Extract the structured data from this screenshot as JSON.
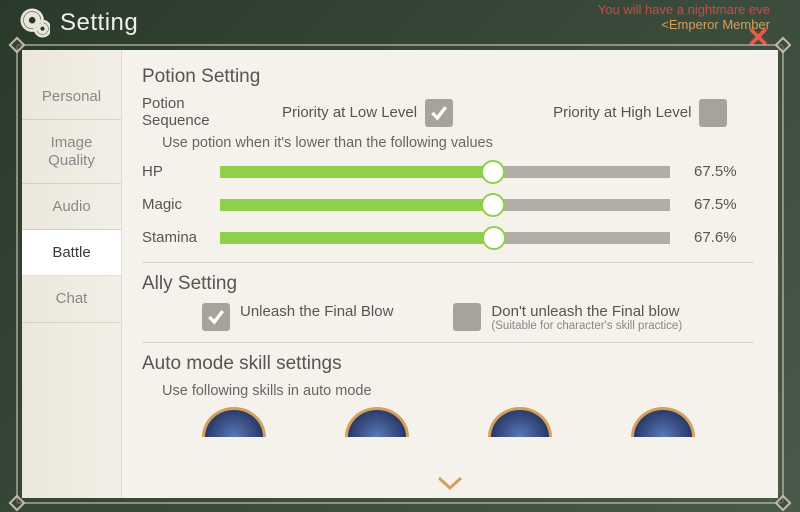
{
  "header": {
    "title": "Setting",
    "top_notice": "You will have a nightmare eve",
    "member_tag": "<Emperor Member"
  },
  "sidebar": {
    "tabs": [
      {
        "label": "Personal",
        "active": false
      },
      {
        "label": "Image Quality",
        "active": false
      },
      {
        "label": "Audio",
        "active": false
      },
      {
        "label": "Battle",
        "active": true
      },
      {
        "label": "Chat",
        "active": false
      }
    ]
  },
  "potion": {
    "section_title": "Potion Setting",
    "sequence_label": "Potion Sequence",
    "priority_low_label": "Priority at Low Level",
    "priority_low_checked": true,
    "priority_high_label": "Priority at High Level",
    "priority_high_checked": false,
    "threshold_hint": "Use potion when it's lower than the following values",
    "sliders": [
      {
        "label": "HP",
        "value_pct": 67.5,
        "display": "67.5%"
      },
      {
        "label": "Magic",
        "value_pct": 67.5,
        "display": "67.5%"
      },
      {
        "label": "Stamina",
        "value_pct": 67.6,
        "display": "67.6%"
      }
    ]
  },
  "ally": {
    "section_title": "Ally Setting",
    "unleash_label": "Unleash the Final Blow",
    "unleash_checked": true,
    "dont_label": "Don't unleash the Final blow",
    "dont_sub": "(Suitable for character's skill practice)",
    "dont_checked": false
  },
  "auto": {
    "section_title": "Auto mode skill settings",
    "hint": "Use following skills in auto mode",
    "skill_count": 4
  }
}
